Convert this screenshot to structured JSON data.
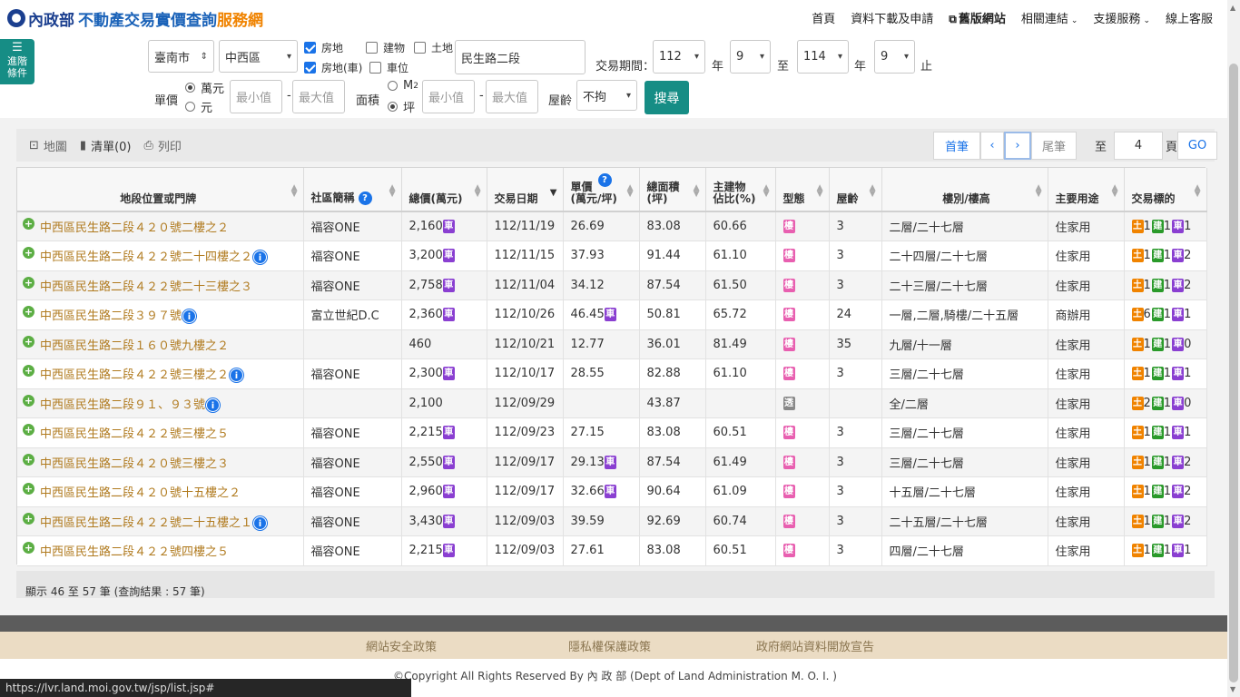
{
  "header": {
    "logo_moi": "內政部",
    "logo_main": "不動產交易實價查詢",
    "logo_sub": "服務網",
    "nav": [
      "首頁",
      "資料下載及申請",
      "舊版網站",
      "相關連結",
      "支援服務",
      "線上客服"
    ]
  },
  "filters": {
    "adv_label_1": "進階",
    "adv_label_2": "條件",
    "city": "臺南市",
    "district": "中西區",
    "type_checks": [
      "房地",
      "建物",
      "土地",
      "房地(車)",
      "車位"
    ],
    "road": "民生路二段",
    "period_label": "交易期間：",
    "from_year": "112",
    "from_month": "9",
    "to_year": "114",
    "to_month": "9",
    "year_unit": "年",
    "to_word": "至",
    "end_word": "止",
    "price_label": "單價",
    "unit_wan": "萬元",
    "unit_yuan": "元",
    "min_ph": "最小值",
    "max_ph": "最大值",
    "dash": "-",
    "area_label": "面積",
    "unit_m2": "M",
    "unit_m2_sup": "2",
    "unit_ping": "坪",
    "age_label": "屋齡",
    "age_value": "不拘",
    "search": "搜尋"
  },
  "toolbar": {
    "map": "地圖",
    "list": "清單(0)",
    "print": "列印",
    "first": "首筆",
    "prev": "‹",
    "next": "›",
    "last": "尾筆",
    "goto_label": "至",
    "page": "4",
    "page_unit": "頁",
    "go": "GO"
  },
  "table": {
    "headers": [
      "地段位置或門牌",
      "社區簡稱",
      "總價(萬元)",
      "交易日期",
      "單價\n(萬元/坪)",
      "總面積\n(坪)",
      "主建物\n佔比(%)",
      "型態",
      "屋齡",
      "樓別/樓高",
      "主要用途",
      "交易標的"
    ],
    "rows": [
      {
        "addr": "中西區民生路二段４２０號二樓之２",
        "info": false,
        "community": "福容ONE",
        "total": "2,160",
        "total_car": true,
        "date": "112/11/19",
        "unit": "26.69",
        "unit_car": false,
        "area": "83.08",
        "ratio": "60.66",
        "type": "樓",
        "age": "3",
        "floor": "二層/二十七層",
        "use": "住家用",
        "tu": "1",
        "jian": "1",
        "che": "1"
      },
      {
        "addr": "中西區民生路二段４２２號二十四樓之２",
        "info": true,
        "community": "福容ONE",
        "total": "3,200",
        "total_car": true,
        "date": "112/11/15",
        "unit": "37.93",
        "unit_car": false,
        "area": "91.44",
        "ratio": "61.10",
        "type": "樓",
        "age": "3",
        "floor": "二十四層/二十七層",
        "use": "住家用",
        "tu": "1",
        "jian": "1",
        "che": "2"
      },
      {
        "addr": "中西區民生路二段４２２號二十三樓之３",
        "info": false,
        "community": "福容ONE",
        "total": "2,758",
        "total_car": true,
        "date": "112/11/04",
        "unit": "34.12",
        "unit_car": false,
        "area": "87.54",
        "ratio": "61.50",
        "type": "樓",
        "age": "3",
        "floor": "二十三層/二十七層",
        "use": "住家用",
        "tu": "1",
        "jian": "1",
        "che": "2"
      },
      {
        "addr": "中西區民生路二段３９７號",
        "info": true,
        "community": "富立世紀D.C",
        "total": "2,360",
        "total_car": true,
        "date": "112/10/26",
        "unit": "46.45",
        "unit_car": true,
        "area": "50.81",
        "ratio": "65.72",
        "type": "樓",
        "age": "24",
        "floor": "一層,二層,騎樓/二十五層",
        "use": "商辦用",
        "tu": "6",
        "jian": "1",
        "che": "1"
      },
      {
        "addr": "中西區民生路二段１６０號九樓之２",
        "info": false,
        "community": "",
        "total": "460",
        "total_car": false,
        "date": "112/10/21",
        "unit": "12.77",
        "unit_car": false,
        "area": "36.01",
        "ratio": "81.49",
        "type": "樓",
        "age": "35",
        "floor": "九層/十一層",
        "use": "住家用",
        "tu": "1",
        "jian": "1",
        "che": "0"
      },
      {
        "addr": "中西區民生路二段４２２號三樓之２",
        "info": true,
        "community": "福容ONE",
        "total": "2,300",
        "total_car": true,
        "date": "112/10/17",
        "unit": "28.55",
        "unit_car": false,
        "area": "82.88",
        "ratio": "61.10",
        "type": "樓",
        "age": "3",
        "floor": "三層/二十七層",
        "use": "住家用",
        "tu": "1",
        "jian": "1",
        "che": "1"
      },
      {
        "addr": "中西區民生路二段９１、９３號",
        "info": true,
        "community": "",
        "total": "2,100",
        "total_car": false,
        "date": "112/09/29",
        "unit": "",
        "unit_car": false,
        "area": "43.87",
        "ratio": "",
        "type": "透",
        "age": "",
        "floor": "全/二層",
        "use": "住家用",
        "tu": "2",
        "jian": "1",
        "che": "0"
      },
      {
        "addr": "中西區民生路二段４２２號三樓之５",
        "info": false,
        "community": "福容ONE",
        "total": "2,215",
        "total_car": true,
        "date": "112/09/23",
        "unit": "27.15",
        "unit_car": false,
        "area": "83.08",
        "ratio": "60.51",
        "type": "樓",
        "age": "3",
        "floor": "三層/二十七層",
        "use": "住家用",
        "tu": "1",
        "jian": "1",
        "che": "1"
      },
      {
        "addr": "中西區民生路二段４２０號三樓之３",
        "info": false,
        "community": "福容ONE",
        "total": "2,550",
        "total_car": true,
        "date": "112/09/17",
        "unit": "29.13",
        "unit_car": true,
        "area": "87.54",
        "ratio": "61.49",
        "type": "樓",
        "age": "3",
        "floor": "三層/二十七層",
        "use": "住家用",
        "tu": "1",
        "jian": "1",
        "che": "2"
      },
      {
        "addr": "中西區民生路二段４２０號十五樓之２",
        "info": false,
        "community": "福容ONE",
        "total": "2,960",
        "total_car": true,
        "date": "112/09/17",
        "unit": "32.66",
        "unit_car": true,
        "area": "90.64",
        "ratio": "61.09",
        "type": "樓",
        "age": "3",
        "floor": "十五層/二十七層",
        "use": "住家用",
        "tu": "1",
        "jian": "1",
        "che": "2"
      },
      {
        "addr": "中西區民生路二段４２２號二十五樓之１",
        "info": true,
        "community": "福容ONE",
        "total": "3,430",
        "total_car": true,
        "date": "112/09/03",
        "unit": "39.59",
        "unit_car": false,
        "area": "92.69",
        "ratio": "60.74",
        "type": "樓",
        "age": "3",
        "floor": "二十五層/二十七層",
        "use": "住家用",
        "tu": "1",
        "jian": "1",
        "che": "2"
      },
      {
        "addr": "中西區民生路二段４２２號四樓之５",
        "info": false,
        "community": "福容ONE",
        "total": "2,215",
        "total_car": true,
        "date": "112/09/03",
        "unit": "27.61",
        "unit_car": false,
        "area": "83.08",
        "ratio": "60.51",
        "type": "樓",
        "age": "3",
        "floor": "四層/二十七層",
        "use": "住家用",
        "tu": "1",
        "jian": "1",
        "che": "1"
      }
    ],
    "badge_car": "車",
    "badge_tu": "土",
    "badge_jian": "建",
    "badge_che": "車",
    "summary": "顯示 46 至 57 筆 (查詢結果 : 57 筆)"
  },
  "footer": {
    "links": [
      "網站安全政策",
      "隱私權保護政策",
      "政府網站資料開放宣告"
    ],
    "copyright": "©Copyright All Rights Reserved By 內 政 部 (Dept of Land Administration M. O. I. )",
    "status_url": "https://lvr.land.moi.gov.tw/jsp/list.jsp#"
  },
  "colors": {
    "accent": "#168d85",
    "link": "#1a73e8",
    "address": "#b07a1e",
    "nav_red": "#e0203c",
    "brand_blue": "#1a62b8",
    "brand_orange": "#f08300"
  }
}
